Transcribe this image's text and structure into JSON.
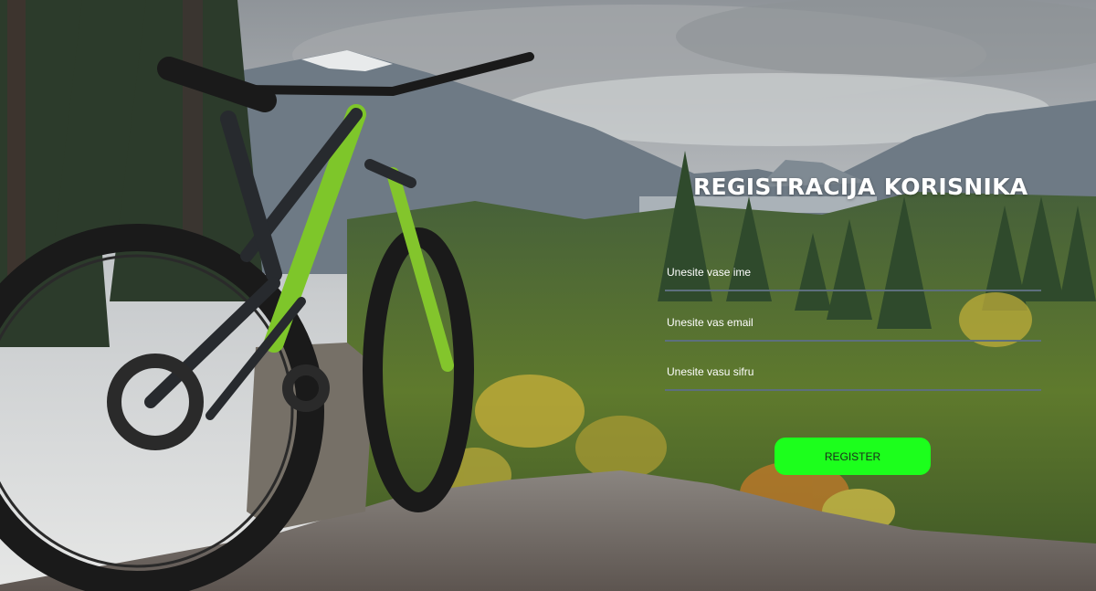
{
  "page": {
    "title": "REGISTRACIJA KORISNIKA"
  },
  "form": {
    "name_placeholder": "Unesite vase ime",
    "email_placeholder": "Unesite vas email",
    "password_placeholder": "Unesite vasu sifru",
    "register_label": "REGISTER"
  },
  "colors": {
    "button": "#1cff1c",
    "underline": "#5d6f7e",
    "title": "#ffffff"
  },
  "background": {
    "description_icon": "mountain-bike-landscape-photo"
  }
}
